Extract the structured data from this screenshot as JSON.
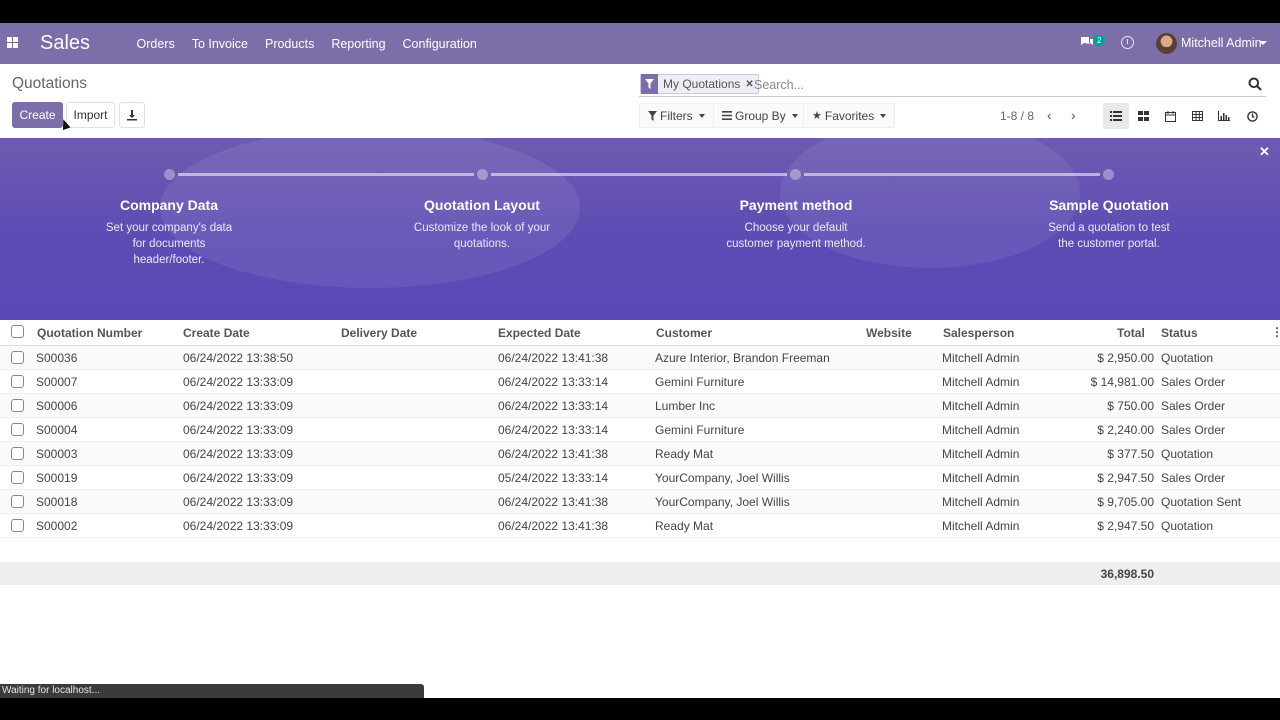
{
  "nav": {
    "app_title": "Sales",
    "menu": [
      "Orders",
      "To Invoice",
      "Products",
      "Reporting",
      "Configuration"
    ],
    "chat_badge": "2",
    "user_name": "Mitchell Admin",
    "accent_color": "#7c6ea9"
  },
  "control": {
    "page_title": "Quotations",
    "create_label": "Create",
    "import_label": "Import",
    "facet_label": "My Quotations",
    "search_placeholder": "Search...",
    "filters_label": "Filters",
    "groupby_label": "Group By",
    "favorites_label": "Favorites",
    "pager": "1-8 / 8",
    "views": [
      "list-icon",
      "kanban-icon",
      "calendar-icon",
      "pivot-icon",
      "graph-icon",
      "activity-icon"
    ]
  },
  "banner": {
    "steps": [
      {
        "title": "Company Data",
        "desc": "Set your company's data for documents header/footer."
      },
      {
        "title": "Quotation Layout",
        "desc": "Customize the look of your quotations."
      },
      {
        "title": "Payment method",
        "desc": "Choose your default customer payment method."
      },
      {
        "title": "Sample Quotation",
        "desc": "Send a quotation to test the customer portal."
      }
    ]
  },
  "table": {
    "columns": [
      "Quotation Number",
      "Create Date",
      "Delivery Date",
      "Expected Date",
      "Customer",
      "Website",
      "Salesperson",
      "Total",
      "Status"
    ],
    "rows": [
      {
        "number": "S00036",
        "create": "06/24/2022 13:38:50",
        "delivery": "",
        "expected": "06/24/2022 13:41:38",
        "customer": "Azure Interior, Brandon Freeman",
        "website": "",
        "salesperson": "Mitchell Admin",
        "total": "$ 2,950.00",
        "status": "Quotation"
      },
      {
        "number": "S00007",
        "create": "06/24/2022 13:33:09",
        "delivery": "",
        "expected": "06/24/2022 13:33:14",
        "customer": "Gemini Furniture",
        "website": "",
        "salesperson": "Mitchell Admin",
        "total": "$ 14,981.00",
        "status": "Sales Order"
      },
      {
        "number": "S00006",
        "create": "06/24/2022 13:33:09",
        "delivery": "",
        "expected": "06/24/2022 13:33:14",
        "customer": "Lumber Inc",
        "website": "",
        "salesperson": "Mitchell Admin",
        "total": "$ 750.00",
        "status": "Sales Order"
      },
      {
        "number": "S00004",
        "create": "06/24/2022 13:33:09",
        "delivery": "",
        "expected": "06/24/2022 13:33:14",
        "customer": "Gemini Furniture",
        "website": "",
        "salesperson": "Mitchell Admin",
        "total": "$ 2,240.00",
        "status": "Sales Order"
      },
      {
        "number": "S00003",
        "create": "06/24/2022 13:33:09",
        "delivery": "",
        "expected": "06/24/2022 13:41:38",
        "customer": "Ready Mat",
        "website": "",
        "salesperson": "Mitchell Admin",
        "total": "$ 377.50",
        "status": "Quotation"
      },
      {
        "number": "S00019",
        "create": "06/24/2022 13:33:09",
        "delivery": "",
        "expected": "05/24/2022 13:33:14",
        "customer": "YourCompany, Joel Willis",
        "website": "",
        "salesperson": "Mitchell Admin",
        "total": "$ 2,947.50",
        "status": "Sales Order"
      },
      {
        "number": "S00018",
        "create": "06/24/2022 13:33:09",
        "delivery": "",
        "expected": "06/24/2022 13:41:38",
        "customer": "YourCompany, Joel Willis",
        "website": "",
        "salesperson": "Mitchell Admin",
        "total": "$ 9,705.00",
        "status": "Quotation Sent"
      },
      {
        "number": "S00002",
        "create": "06/24/2022 13:33:09",
        "delivery": "",
        "expected": "06/24/2022 13:41:38",
        "customer": "Ready Mat",
        "website": "",
        "salesperson": "Mitchell Admin",
        "total": "$ 2,947.50",
        "status": "Quotation"
      }
    ],
    "total_sum": "36,898.50"
  },
  "statusbar": "Waiting for localhost..."
}
